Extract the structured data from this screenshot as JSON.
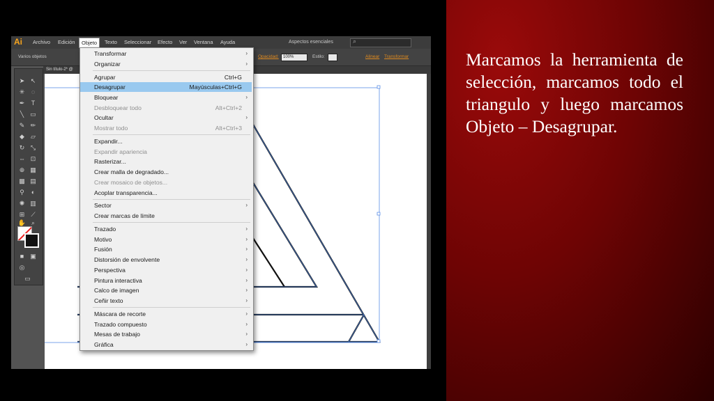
{
  "caption": "Marcamos la herramienta de selección, marcamos todo el triangulo y luego marcamos Objeto – Desagrupar.",
  "app": {
    "logo": "Ai",
    "menus": [
      "Archivo",
      "Edición",
      "Objeto",
      "Texto",
      "Seleccionar",
      "Efecto",
      "Ver",
      "Ventana",
      "Ayuda"
    ],
    "workspace": "Aspectos esenciales",
    "search_icon": "search-icon"
  },
  "control_bar": {
    "selection_label": "Varios objetos",
    "opacity_label": "Opacidad:",
    "opacity_value": "100%",
    "style_label": "Estilo:",
    "align_label": "Alinear",
    "transform_label": "Transformar"
  },
  "document_tab": "Sin título-2* @",
  "object_menu": {
    "groups": [
      [
        {
          "label": "Transformar",
          "submenu": true
        },
        {
          "label": "Organizar",
          "submenu": true
        }
      ],
      [
        {
          "label": "Agrupar",
          "shortcut": "Ctrl+G"
        },
        {
          "label": "Desagrupar",
          "shortcut": "Mayúsculas+Ctrl+G",
          "highlighted": true
        },
        {
          "label": "Bloquear",
          "submenu": true
        },
        {
          "label": "Desbloquear todo",
          "shortcut": "Alt+Ctrl+2",
          "disabled": true
        },
        {
          "label": "Ocultar",
          "submenu": true
        },
        {
          "label": "Mostrar todo",
          "shortcut": "Alt+Ctrl+3",
          "disabled": true
        }
      ],
      [
        {
          "label": "Expandir..."
        },
        {
          "label": "Expandir apariencia",
          "disabled": true
        },
        {
          "label": "Rasterizar..."
        },
        {
          "label": "Crear malla de degradado..."
        },
        {
          "label": "Crear mosaico de objetos...",
          "disabled": true
        },
        {
          "label": "Acoplar transparencia..."
        }
      ],
      [
        {
          "label": "Sector",
          "submenu": true
        },
        {
          "label": "Crear marcas de límite"
        }
      ],
      [
        {
          "label": "Trazado",
          "submenu": true
        },
        {
          "label": "Motivo",
          "submenu": true
        },
        {
          "label": "Fusión",
          "submenu": true
        },
        {
          "label": "Distorsión de envolvente",
          "submenu": true
        },
        {
          "label": "Perspectiva",
          "submenu": true
        },
        {
          "label": "Pintura interactiva",
          "submenu": true
        },
        {
          "label": "Calco de imagen",
          "submenu": true
        },
        {
          "label": "Ceñir texto",
          "submenu": true
        }
      ],
      [
        {
          "label": "Máscara de recorte",
          "submenu": true
        },
        {
          "label": "Trazado compuesto",
          "submenu": true
        },
        {
          "label": "Mesas de trabajo",
          "submenu": true
        },
        {
          "label": "Gráfica",
          "submenu": true
        }
      ]
    ]
  },
  "colors": {
    "accent_red": "#8a0505",
    "menu_highlight": "#99c9ef",
    "selection_blue": "#4a7fd6"
  }
}
